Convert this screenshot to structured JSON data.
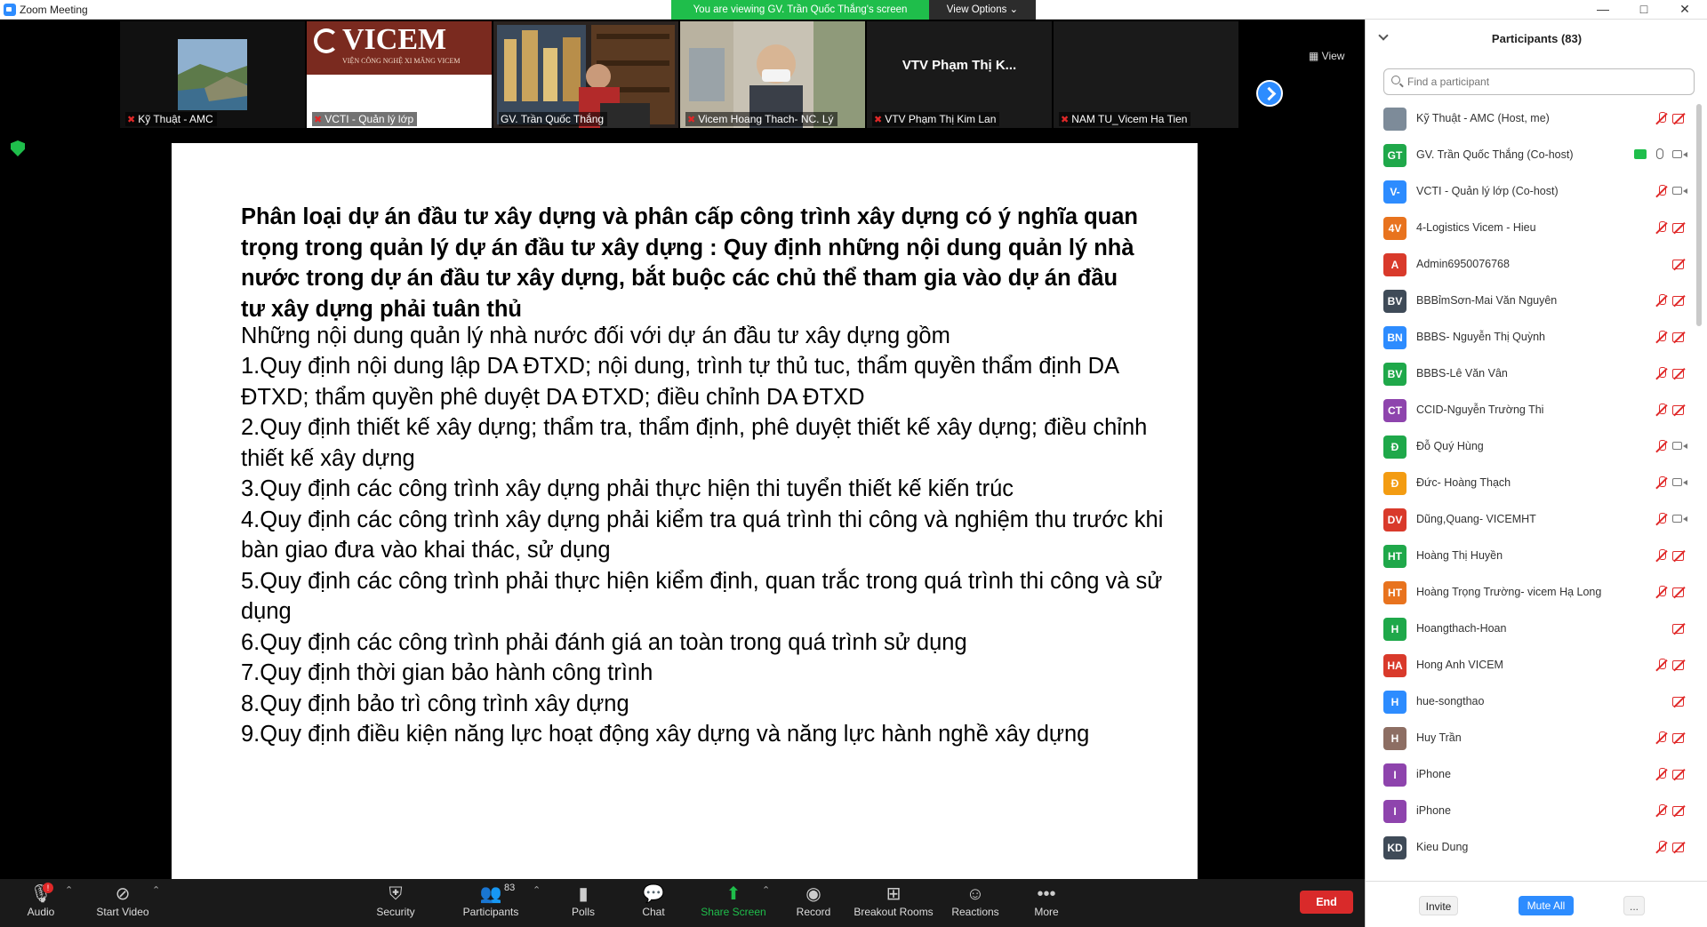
{
  "window": {
    "title": "Zoom Meeting",
    "min": "—",
    "max": "□",
    "close": "✕"
  },
  "banner": {
    "text": "You are viewing GV. Trần Quốc Thắng's screen",
    "options_label": "View Options ⌄"
  },
  "video_strip": {
    "view_label": "View",
    "tiles": [
      {
        "name": "Kỹ Thuật - AMC",
        "big_name": ""
      },
      {
        "name": "VCTI - Quản lý lớp",
        "big_name": ""
      },
      {
        "name": "GV. Trần Quốc Thắng",
        "big_name": ""
      },
      {
        "name": "Vicem Hoang Thach- NC. Lý",
        "big_name": ""
      },
      {
        "name": "VTV Phạm Thị Kim Lan",
        "big_name": "VTV Phạm Thị K..."
      },
      {
        "name": "NAM TU_Vicem Ha Tien",
        "big_name": ""
      }
    ],
    "logo_text": "VICEM",
    "logo_subtext": "VIỆN CÔNG NGHỆ XI MĂNG VICEM"
  },
  "slide": {
    "heading": "Phân loại dự án đầu tư xây dựng và phân cấp công trình xây dựng có ý nghĩa quan trọng trong quản lý dự án đầu tư xây dựng : Quy định những nội dung quản lý nhà nước trong dự án đầu tư xây dựng, bắt buộc các chủ thể tham gia vào dự án đầu tư xây dựng phải tuân thủ",
    "intro": "Những nội dung quản lý nhà nước đối với dự án đầu tư xây dựng gồm",
    "items": [
      "1.Quy định nội dung lập DA ĐTXD; nội dung, trình tự thủ tuc, thẩm quyền thẩm định DA ĐTXD;  thẩm quyền phê duyệt DA ĐTXD; điều chỉnh DA ĐTXD",
      "2.Quy định thiết kế xây dựng; thẩm tra, thẩm định, phê duyệt thiết kế xây dựng; điều chỉnh thiết kế xây dựng",
      "3.Quy định các công trình xây dựng phải thực hiện thi tuyển thiết kế kiến trúc",
      "4.Quy định các công trình xây dựng phải kiểm tra quá trình thi công và nghiệm thu trước khi bàn giao đưa vào khai thác, sử dụng",
      "5.Quy định các công trình phải thực hiện kiểm định, quan trắc trong quá trình thi công và sử dụng",
      "6.Quy định  các công trình phải đánh giá an toàn trong quá trình sử dụng",
      "7.Quy định thời gian bảo hành công trình",
      "8.Quy định bảo trì công trình xây dựng",
      "9.Quy định điều kiện năng lực hoạt động xây dựng và năng lực hành nghề xây dựng"
    ]
  },
  "toolbar": {
    "audio": "Audio",
    "start_video": "Start Video",
    "security": "Security",
    "participants": "Participants",
    "participants_count": "83",
    "polls": "Polls",
    "chat": "Chat",
    "share_screen": "Share Screen",
    "record": "Record",
    "breakout_rooms": "Breakout Rooms",
    "reactions": "Reactions",
    "more": "More",
    "end": "End",
    "audio_badge": "!"
  },
  "panel": {
    "title": "Participants (83)",
    "search_placeholder": "Find a participant",
    "invite": "Invite",
    "mute_all": "Mute All",
    "more": "...",
    "participants": [
      {
        "initials": "",
        "name": "Kỹ Thuật - AMC (Host, me)",
        "color": "#7d8b99",
        "mic": "off",
        "cam": "off"
      },
      {
        "initials": "GT",
        "name": "GV. Trần Quốc Thắng (Co-host)",
        "color": "#1fa84a",
        "mic": "on",
        "cam": "on",
        "sharing": true
      },
      {
        "initials": "V-",
        "name": "VCTI - Quản lý lớp (Co-host)",
        "color": "#2d8cff",
        "mic": "off",
        "cam": "on"
      },
      {
        "initials": "4V",
        "name": "4-Logistics Vicem - Hieu",
        "color": "#e8731e",
        "mic": "off",
        "cam": "off"
      },
      {
        "initials": "A",
        "name": "Admin6950076768",
        "color": "#d93a2b",
        "mic": "none",
        "cam": "off"
      },
      {
        "initials": "BV",
        "name": "BBBỉmSơn-Mai Văn Nguyên",
        "color": "#3f4b58",
        "mic": "off",
        "cam": "off"
      },
      {
        "initials": "BN",
        "name": "BBBS- Nguyễn Thị Quỳnh",
        "color": "#2d8cff",
        "mic": "off",
        "cam": "off"
      },
      {
        "initials": "BV",
        "name": "BBBS-Lê Văn Vân",
        "color": "#1fa84a",
        "mic": "off",
        "cam": "off"
      },
      {
        "initials": "CT",
        "name": "CCID-Nguyễn Trường Thi",
        "color": "#8e44ad",
        "mic": "off",
        "cam": "off"
      },
      {
        "initials": "Đ",
        "name": "Đỗ Quý Hùng",
        "color": "#1fa84a",
        "mic": "off",
        "cam": "on"
      },
      {
        "initials": "Đ",
        "name": "Đức- Hoàng Thạch",
        "color": "#f39c12",
        "mic": "off",
        "cam": "on"
      },
      {
        "initials": "DV",
        "name": "Dũng,Quang- VICEMHT",
        "color": "#d93a2b",
        "mic": "off",
        "cam": "on"
      },
      {
        "initials": "HT",
        "name": "Hoàng Thị Huyền",
        "color": "#1fa84a",
        "mic": "off",
        "cam": "off"
      },
      {
        "initials": "HT",
        "name": "Hoàng Trọng Trường- vicem Hạ Long",
        "color": "#e8731e",
        "mic": "off",
        "cam": "off"
      },
      {
        "initials": "H",
        "name": "Hoangthach-Hoan",
        "color": "#1fa84a",
        "mic": "none",
        "cam": "off"
      },
      {
        "initials": "HA",
        "name": "Hong Anh VICEM",
        "color": "#d93a2b",
        "mic": "off",
        "cam": "off"
      },
      {
        "initials": "H",
        "name": "hue-songthao",
        "color": "#2d8cff",
        "mic": "none",
        "cam": "off"
      },
      {
        "initials": "H",
        "name": "Huy Trần",
        "color": "#8d6e63",
        "mic": "off",
        "cam": "off"
      },
      {
        "initials": "I",
        "name": "iPhone",
        "color": "#8e44ad",
        "mic": "off",
        "cam": "off"
      },
      {
        "initials": "I",
        "name": "iPhone",
        "color": "#8e44ad",
        "mic": "off",
        "cam": "off"
      },
      {
        "initials": "KD",
        "name": "Kieu Dung",
        "color": "#3f4b58",
        "mic": "off",
        "cam": "off"
      }
    ]
  }
}
